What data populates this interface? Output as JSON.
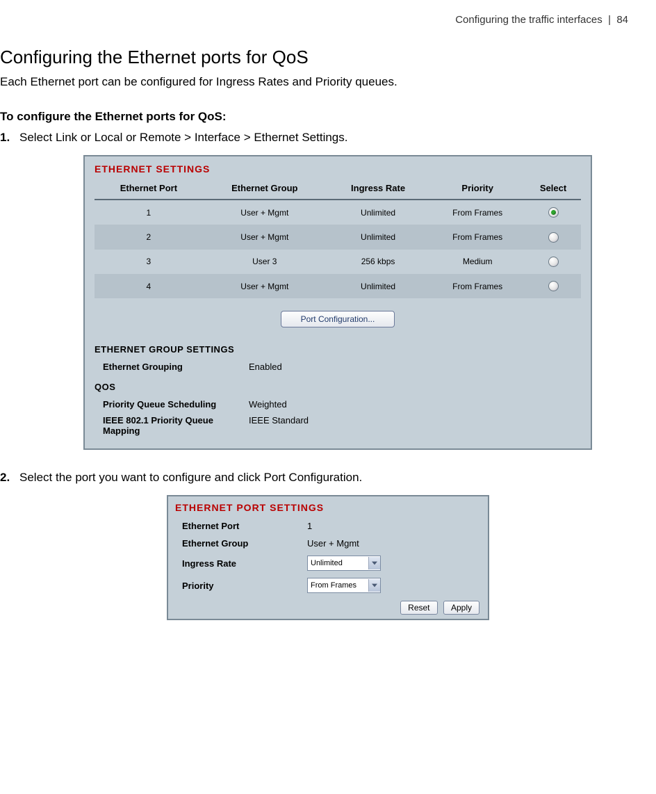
{
  "header": {
    "left": "Configuring the traffic interfaces",
    "sep": "|",
    "page": "84"
  },
  "title": "Configuring the Ethernet ports for QoS",
  "intro": "Each Ethernet port can be configured for Ingress Rates and Priority queues.",
  "subheading": "To configure the Ethernet ports for QoS:",
  "steps": {
    "s1_num": "1.",
    "s1_text": "Select Link or Local or Remote > Interface > Ethernet Settings.",
    "s2_num": "2.",
    "s2_text": "Select the port you want to configure and click Port Configuration."
  },
  "panel1": {
    "title": "ETHERNET SETTINGS",
    "cols": {
      "port": "Ethernet Port",
      "group": "Ethernet Group",
      "rate": "Ingress Rate",
      "prio": "Priority",
      "sel": "Select"
    },
    "rows": [
      {
        "port": "1",
        "group": "User + Mgmt",
        "rate": "Unlimited",
        "prio": "From Frames",
        "selected": true
      },
      {
        "port": "2",
        "group": "User + Mgmt",
        "rate": "Unlimited",
        "prio": "From Frames",
        "selected": false
      },
      {
        "port": "3",
        "group": "User 3",
        "rate": "256 kbps",
        "prio": "Medium",
        "selected": false
      },
      {
        "port": "4",
        "group": "User + Mgmt",
        "rate": "Unlimited",
        "prio": "From Frames",
        "selected": false
      }
    ],
    "button": "Port Configuration...",
    "group_settings_title": "ETHERNET GROUP SETTINGS",
    "group_label": "Ethernet Grouping",
    "group_value": "Enabled",
    "qos_title": "QOS",
    "qos1_label": "Priority Queue Scheduling",
    "qos1_value": "Weighted",
    "qos2_label": "IEEE 802.1 Priority Queue Mapping",
    "qos2_value": "IEEE Standard"
  },
  "panel2": {
    "title": "ETHERNET PORT SETTINGS",
    "port_label": "Ethernet Port",
    "port_value": "1",
    "group_label": "Ethernet Group",
    "group_value": "User + Mgmt",
    "rate_label": "Ingress Rate",
    "rate_value": "Unlimited",
    "prio_label": "Priority",
    "prio_value": "From Frames",
    "reset": "Reset",
    "apply": "Apply"
  }
}
